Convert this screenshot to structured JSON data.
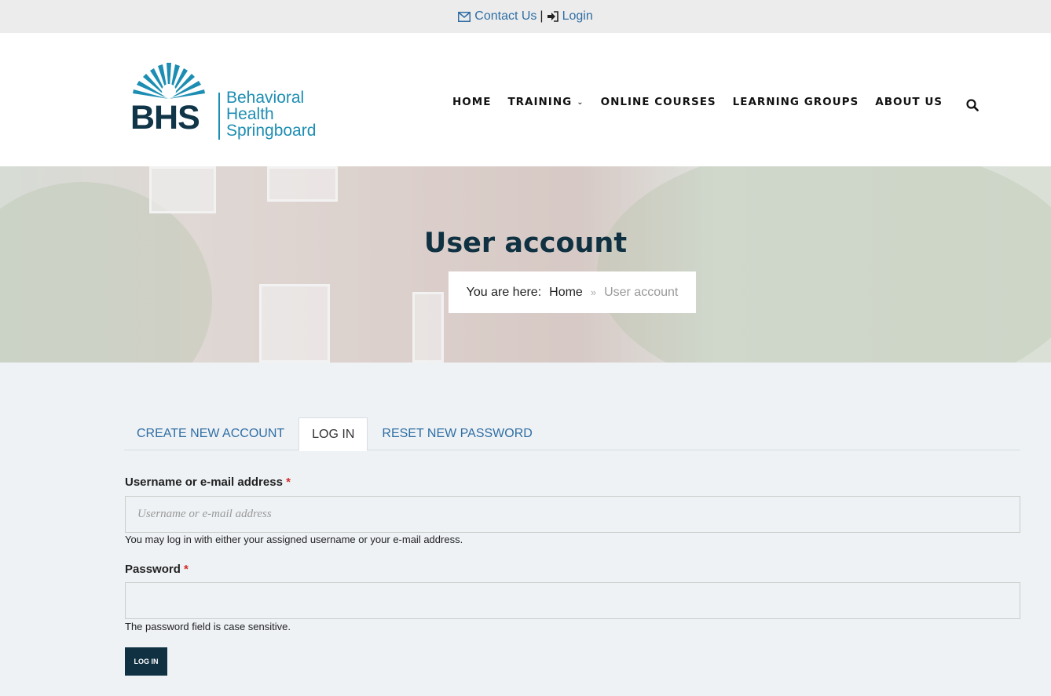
{
  "topbar": {
    "contact_label": "Contact Us",
    "separator": "|",
    "login_label": "Login"
  },
  "logo": {
    "mark_text": "BHS",
    "line1": "Behavioral",
    "line2": "Health",
    "line3": "Springboard"
  },
  "nav": {
    "items": [
      {
        "label": "HOME"
      },
      {
        "label": "TRAINING"
      },
      {
        "label": "ONLINE COURSES"
      },
      {
        "label": "LEARNING GROUPS"
      },
      {
        "label": "ABOUT US"
      }
    ],
    "search_icon": "search-icon"
  },
  "hero": {
    "title": "User account",
    "breadcrumb_prefix": "You are here:",
    "breadcrumb_home": "Home",
    "breadcrumb_separator": "»",
    "breadcrumb_current": "User account"
  },
  "tabs": [
    {
      "label": "CREATE NEW ACCOUNT",
      "active": false
    },
    {
      "label": "LOG IN",
      "active": true
    },
    {
      "label": "RESET NEW PASSWORD",
      "active": false
    }
  ],
  "form": {
    "username_label": "Username or e-mail address",
    "required_mark": "*",
    "username_placeholder": "Username or e-mail address",
    "username_value": "",
    "username_help": "You may log in with either your assigned username or your e-mail address.",
    "password_label": "Password",
    "password_value": "",
    "password_help": "The password field is case sensitive.",
    "submit_label": "LOG IN"
  },
  "colors": {
    "link": "#2f6ea4",
    "dark_navy": "#0f3142",
    "brand_teal": "#1d8eb3",
    "required": "#d42a2a",
    "page_bg": "#eef2f5"
  }
}
